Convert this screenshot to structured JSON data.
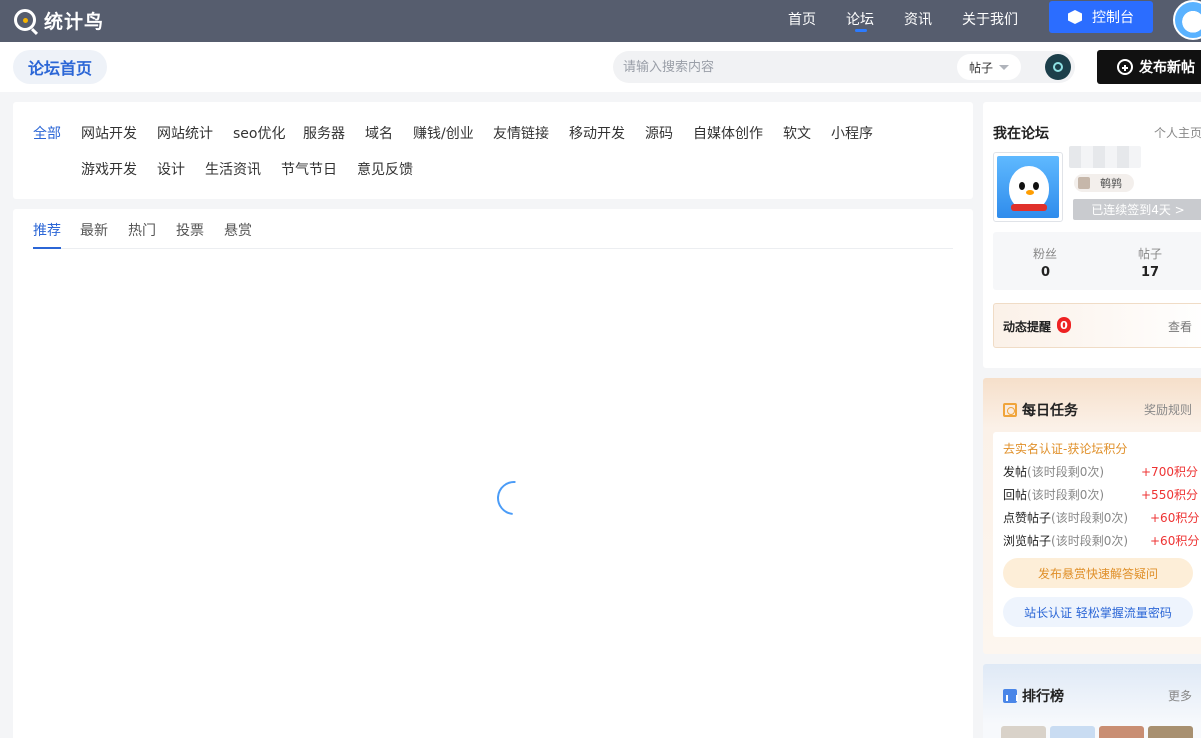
{
  "app": {
    "logo_text": "统计鸟"
  },
  "nav": {
    "items": [
      "首页",
      "论坛",
      "资讯",
      "关于我们"
    ],
    "active_index": 1,
    "console_label": "控制台"
  },
  "subbar": {
    "forum_home": "论坛首页",
    "search_placeholder": "请输入搜索内容",
    "search_type": "帖子",
    "post_button": "发布新帖"
  },
  "categories": {
    "row1": [
      "全部",
      "网站开发",
      "网站统计",
      "seo优化",
      "服务器",
      "域名",
      "赚钱/创业",
      "友情链接",
      "移动开发",
      "源码",
      "自媒体创作",
      "软文",
      "小程序"
    ],
    "row2": [
      "游戏开发",
      "设计",
      "生活资讯",
      "节气节日",
      "意见反馈"
    ],
    "active": "全部"
  },
  "feed": {
    "tabs": [
      "推荐",
      "最新",
      "热门",
      "投票",
      "悬赏"
    ],
    "active_tab": "推荐"
  },
  "my_forum": {
    "title": "我在论坛",
    "home_link": "个人主页",
    "rank": "鹌鹑",
    "checkin": "已连续签到4天 >",
    "fans_label": "粉丝",
    "fans_value": "0",
    "posts_label": "帖子",
    "posts_value": "17",
    "remind_title": "动态提醒",
    "remind_count": "0",
    "remind_link": "查看"
  },
  "daily_tasks": {
    "title": "每日任务",
    "rules_link": "奖励规则",
    "verify": "去实名认证-获论坛积分",
    "rows": [
      {
        "name": "发帖",
        "sub": "(该时段剩0次)",
        "points": "+700积分"
      },
      {
        "name": "回帖",
        "sub": "(该时段剩0次)",
        "points": "+550积分"
      },
      {
        "name": "点赞帖子",
        "sub": "(该时段剩0次)",
        "points": "+60积分"
      },
      {
        "name": "浏览帖子",
        "sub": "(该时段剩0次)",
        "points": "+60积分"
      }
    ],
    "bounty_button": "发布悬赏快速解答疑问",
    "master_button": "站长认证 轻松掌握流量密码"
  },
  "ranking": {
    "title": "排行榜",
    "more": "更多"
  },
  "colors": {
    "accent": "#2b66d6",
    "topbar": "#565d6e",
    "console": "#2b6dff",
    "points_red": "#ee3333",
    "task_orange": "#e0902a"
  }
}
